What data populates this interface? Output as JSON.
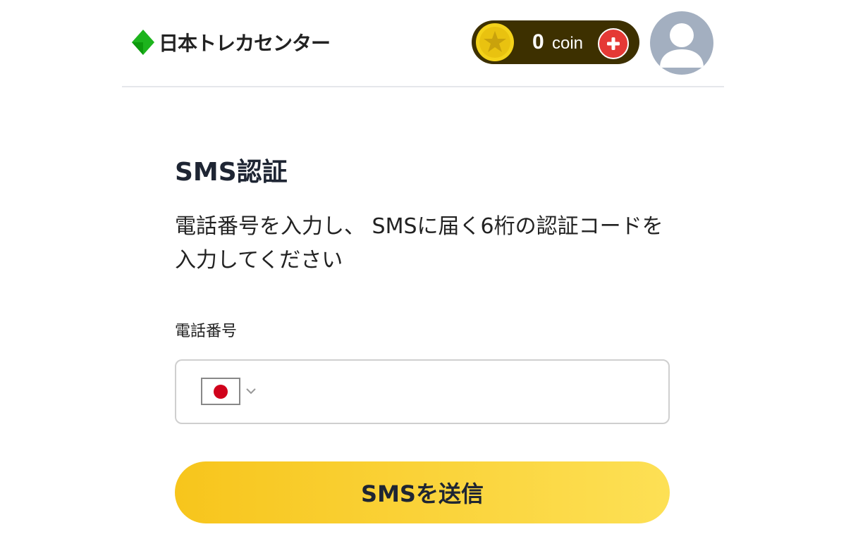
{
  "header": {
    "logo_text": "日本トレカセンター",
    "coin_amount": "0",
    "coin_unit": "coin",
    "brand_color": "#1db41d",
    "coin_bg_color": "#3d3000",
    "add_button_color": "#e53935",
    "avatar_color": "#a3afc0",
    "icons": {
      "logo": "green-diamond-logo-icon",
      "coin": "gold-star-coin-icon",
      "add": "plus-icon",
      "avatar": "user-avatar-icon"
    }
  },
  "main": {
    "title": "SMS認証",
    "instructions": "電話番号を入力し、 SMSに届く6桁の認証コードを入力してください",
    "phone_label": "電話番号",
    "phone_input": {
      "value": "",
      "placeholder": ""
    },
    "country": {
      "flag": "japan-flag-icon",
      "chevron": "chevron-down-icon"
    },
    "send_button_label": "SMSを送信",
    "button_gradient": [
      "#f7c51c",
      "#fde055"
    ]
  }
}
